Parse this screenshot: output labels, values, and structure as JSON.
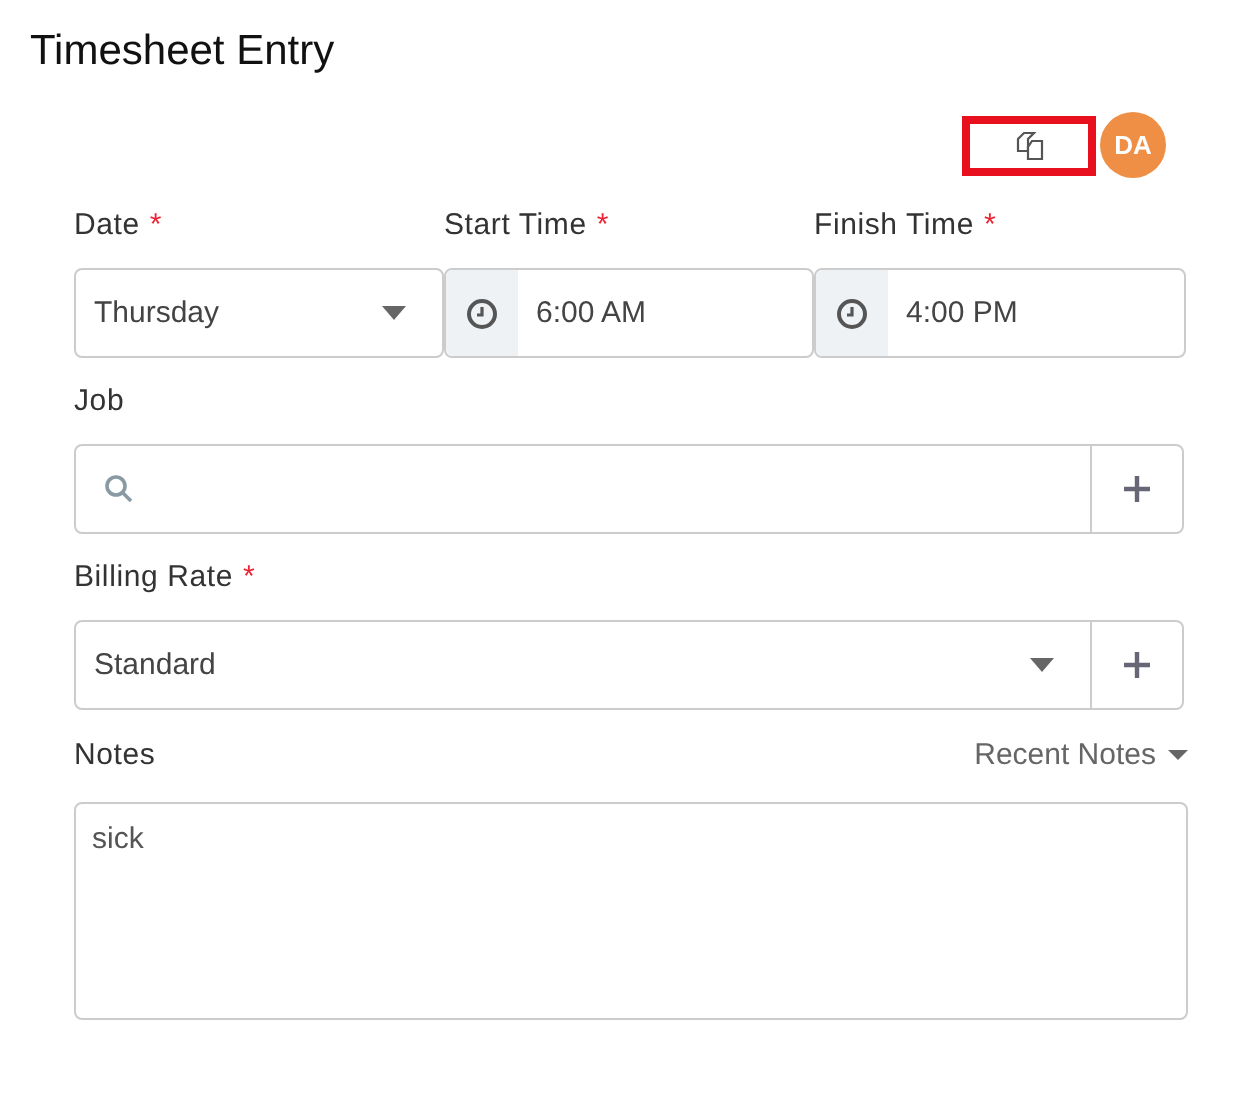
{
  "title": "Timesheet Entry",
  "toolbar": {
    "copy_highlighted": true,
    "avatar": {
      "initials": "DA",
      "color": "#ee8f45"
    }
  },
  "time_fields": [
    {
      "kind": "select",
      "label": "Date",
      "required_mark": "*",
      "value": "Thursday"
    },
    {
      "kind": "time",
      "label": "Start Time",
      "required_mark": "*",
      "value": "6:00 AM"
    },
    {
      "kind": "time",
      "label": "Finish Time",
      "required_mark": "*",
      "value": "4:00 PM"
    }
  ],
  "job": {
    "label": "Job"
  },
  "billing_rate": {
    "label": "Billing Rate",
    "required_mark": "*",
    "value": "Standard"
  },
  "notes": {
    "label": "Notes",
    "recent_notes": "Recent Notes",
    "value": "sick"
  }
}
